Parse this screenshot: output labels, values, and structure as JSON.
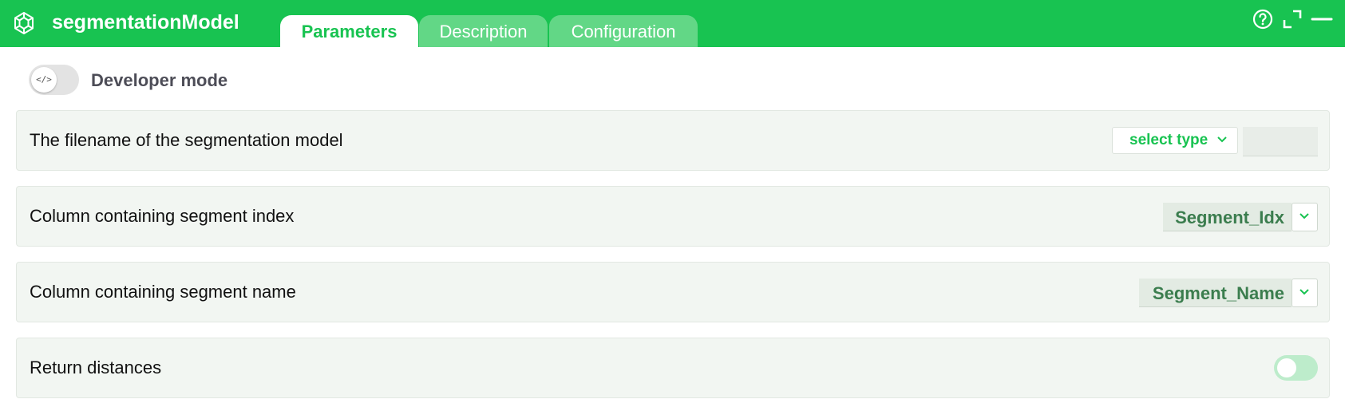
{
  "app": {
    "title": "segmentationModel",
    "icon": "network-cube-icon"
  },
  "tabs": [
    {
      "label": "Parameters",
      "active": true
    },
    {
      "label": "Description",
      "active": false
    },
    {
      "label": "Configuration",
      "active": false
    }
  ],
  "header_icons": [
    "help-icon",
    "expand-icon",
    "minimize-icon"
  ],
  "developer_mode": {
    "label": "Developer mode",
    "knob_icon": "</>",
    "enabled": false
  },
  "params": [
    {
      "label": "The filename of the segmentation model",
      "control": "type-select",
      "select_label": "select type",
      "value": ""
    },
    {
      "label": "Column containing segment index",
      "control": "column-select",
      "value": "Segment_Idx"
    },
    {
      "label": "Column containing segment name",
      "control": "column-select",
      "value": "Segment_Name"
    },
    {
      "label": "Return distances",
      "control": "toggle",
      "enabled": false
    }
  ],
  "colors": {
    "accent": "#18c351",
    "tab_inactive": "#62d786",
    "row_bg": "#f2f6f2",
    "value_text": "#3b7d4e"
  }
}
